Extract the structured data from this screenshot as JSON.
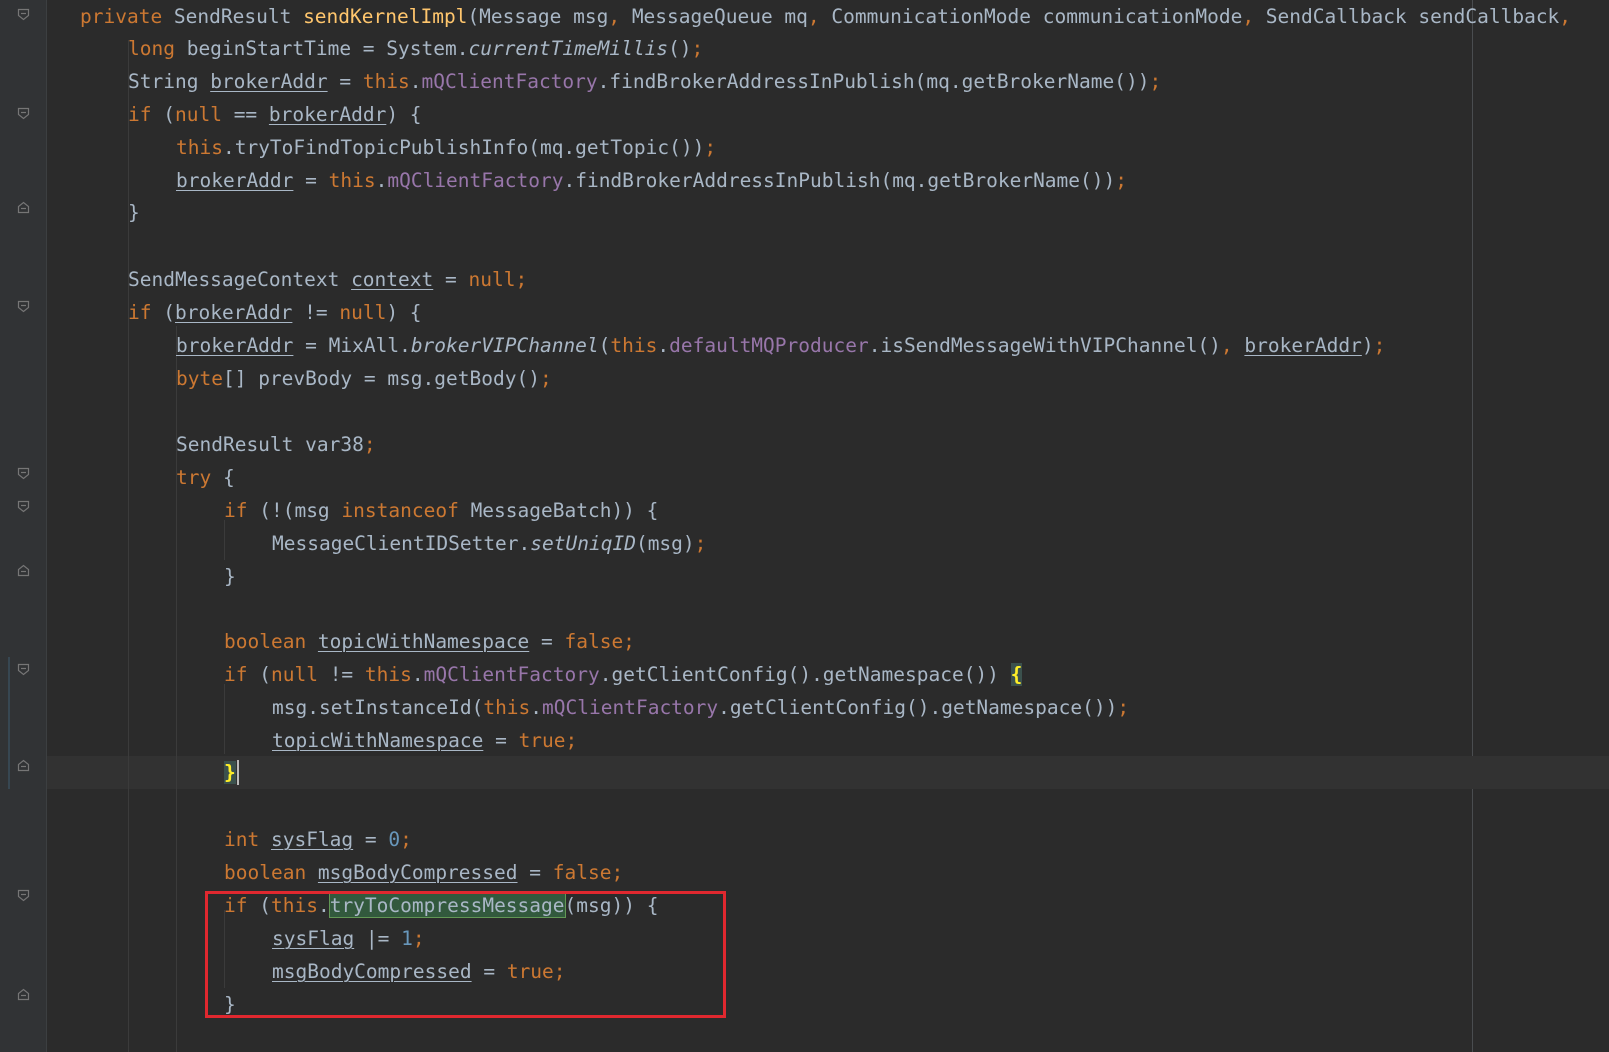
{
  "editor": {
    "language": "Java",
    "theme_colors": {
      "background": "#2b2b2b",
      "keyword": "#cc7832",
      "method_declaration": "#ffc66d",
      "field": "#9876aa",
      "number": "#6897bb",
      "default_text": "#a9b7c6",
      "annotation_box": "#e0282f"
    },
    "lines": [
      [
        {
          "t": "private ",
          "c": "kw"
        },
        {
          "t": "SendResult "
        },
        {
          "t": "sendKernelImpl",
          "c": "fn"
        },
        {
          "t": "(Message msg"
        },
        {
          "t": ", ",
          "c": "kw"
        },
        {
          "t": "MessageQueue mq"
        },
        {
          "t": ", ",
          "c": "kw"
        },
        {
          "t": "CommunicationMode communicationMode"
        },
        {
          "t": ", ",
          "c": "kw"
        },
        {
          "t": "SendCallback sendCallback"
        },
        {
          "t": ",",
          "c": "kw"
        }
      ],
      [
        {
          "t": "long ",
          "c": "kw"
        },
        {
          "t": "beginStartTime = System."
        },
        {
          "t": "currentTimeMillis",
          "c": "st"
        },
        {
          "t": "()"
        },
        {
          "t": ";",
          "c": "kw"
        }
      ],
      [
        {
          "t": "String "
        },
        {
          "t": "brokerAddr",
          "c": "var"
        },
        {
          "t": " = "
        },
        {
          "t": "this",
          "c": "kw"
        },
        {
          "t": "."
        },
        {
          "t": "mQClientFactory",
          "c": "fld"
        },
        {
          "t": ".findBrokerAddressInPublish(mq.getBrokerName())"
        },
        {
          "t": ";",
          "c": "kw"
        }
      ],
      [
        {
          "t": "if ",
          "c": "kw"
        },
        {
          "t": "("
        },
        {
          "t": "null ",
          "c": "kw"
        },
        {
          "t": "== "
        },
        {
          "t": "brokerAddr",
          "c": "var"
        },
        {
          "t": ") {"
        }
      ],
      [
        {
          "t": "this",
          "c": "kw"
        },
        {
          "t": ".tryToFindTopicPublishInfo(mq.getTopic())"
        },
        {
          "t": ";",
          "c": "kw"
        }
      ],
      [
        {
          "t": "brokerAddr",
          "c": "var"
        },
        {
          "t": " = "
        },
        {
          "t": "this",
          "c": "kw"
        },
        {
          "t": "."
        },
        {
          "t": "mQClientFactory",
          "c": "fld"
        },
        {
          "t": ".findBrokerAddressInPublish(mq.getBrokerName())"
        },
        {
          "t": ";",
          "c": "kw"
        }
      ],
      [
        {
          "t": "}"
        }
      ],
      [],
      [
        {
          "t": "SendMessageContext "
        },
        {
          "t": "context",
          "c": "var"
        },
        {
          "t": " = "
        },
        {
          "t": "null;",
          "c": "kw"
        }
      ],
      [
        {
          "t": "if ",
          "c": "kw"
        },
        {
          "t": "("
        },
        {
          "t": "brokerAddr",
          "c": "var"
        },
        {
          "t": " != "
        },
        {
          "t": "null",
          "c": "kw"
        },
        {
          "t": ") {"
        }
      ],
      [
        {
          "t": "brokerAddr",
          "c": "var"
        },
        {
          "t": " = MixAll."
        },
        {
          "t": "brokerVIPChannel",
          "c": "st"
        },
        {
          "t": "("
        },
        {
          "t": "this",
          "c": "kw"
        },
        {
          "t": "."
        },
        {
          "t": "defaultMQProducer",
          "c": "fld"
        },
        {
          "t": ".isSendMessageWithVIPChannel()"
        },
        {
          "t": ", ",
          "c": "kw"
        },
        {
          "t": "brokerAddr",
          "c": "var"
        },
        {
          "t": ")"
        },
        {
          "t": ";",
          "c": "kw"
        }
      ],
      [
        {
          "t": "byte",
          "c": "kw"
        },
        {
          "t": "[] prevBody = msg.getBody()"
        },
        {
          "t": ";",
          "c": "kw"
        }
      ],
      [],
      [
        {
          "t": "SendResult var38"
        },
        {
          "t": ";",
          "c": "kw"
        }
      ],
      [
        {
          "t": "try ",
          "c": "kw"
        },
        {
          "t": "{"
        }
      ],
      [
        {
          "t": "if ",
          "c": "kw"
        },
        {
          "t": "(!(msg "
        },
        {
          "t": "instanceof ",
          "c": "kw"
        },
        {
          "t": "MessageBatch)) {"
        }
      ],
      [
        {
          "t": "MessageClientIDSetter."
        },
        {
          "t": "setUniqID",
          "c": "st"
        },
        {
          "t": "(msg)"
        },
        {
          "t": ";",
          "c": "kw"
        }
      ],
      [
        {
          "t": "}"
        }
      ],
      [],
      [
        {
          "t": "boolean ",
          "c": "kw"
        },
        {
          "t": "topicWithNamespace",
          "c": "var"
        },
        {
          "t": " = "
        },
        {
          "t": "false;",
          "c": "kw"
        }
      ],
      [
        {
          "t": "if ",
          "c": "kw"
        },
        {
          "t": "("
        },
        {
          "t": "null ",
          "c": "kw"
        },
        {
          "t": "!= "
        },
        {
          "t": "this",
          "c": "kw"
        },
        {
          "t": "."
        },
        {
          "t": "mQClientFactory",
          "c": "fld"
        },
        {
          "t": ".getClientConfig().getNamespace()) "
        },
        {
          "t": "{",
          "c": "brace-match"
        }
      ],
      [
        {
          "t": "msg.setInstanceId("
        },
        {
          "t": "this",
          "c": "kw"
        },
        {
          "t": "."
        },
        {
          "t": "mQClientFactory",
          "c": "fld"
        },
        {
          "t": ".getClientConfig().getNamespace())"
        },
        {
          "t": ";",
          "c": "kw"
        }
      ],
      [
        {
          "t": "topicWithNamespace",
          "c": "var"
        },
        {
          "t": " = "
        },
        {
          "t": "true;",
          "c": "kw"
        }
      ],
      [
        {
          "t": "}",
          "c": "brace-match"
        }
      ],
      [],
      [
        {
          "t": "int ",
          "c": "kw"
        },
        {
          "t": "sysFlag",
          "c": "var"
        },
        {
          "t": " = "
        },
        {
          "t": "0",
          "c": "num"
        },
        {
          "t": ";",
          "c": "kw"
        }
      ],
      [
        {
          "t": "boolean ",
          "c": "kw"
        },
        {
          "t": "msgBodyCompressed",
          "c": "var"
        },
        {
          "t": " = "
        },
        {
          "t": "false;",
          "c": "kw"
        }
      ],
      [
        {
          "t": "if ",
          "c": "kw"
        },
        {
          "t": "("
        },
        {
          "t": "this",
          "c": "kw"
        },
        {
          "t": "."
        },
        {
          "t": "tryToCompressMessage",
          "c": "usage-hl"
        },
        {
          "t": "(msg)) {"
        }
      ],
      [
        {
          "t": "sysFlag",
          "c": "var"
        },
        {
          "t": " |= "
        },
        {
          "t": "1",
          "c": "num"
        },
        {
          "t": ";",
          "c": "kw"
        }
      ],
      [
        {
          "t": "msgBodyCompressed",
          "c": "var"
        },
        {
          "t": " = "
        },
        {
          "t": "true;",
          "c": "kw"
        }
      ],
      [
        {
          "t": "}"
        }
      ]
    ]
  }
}
